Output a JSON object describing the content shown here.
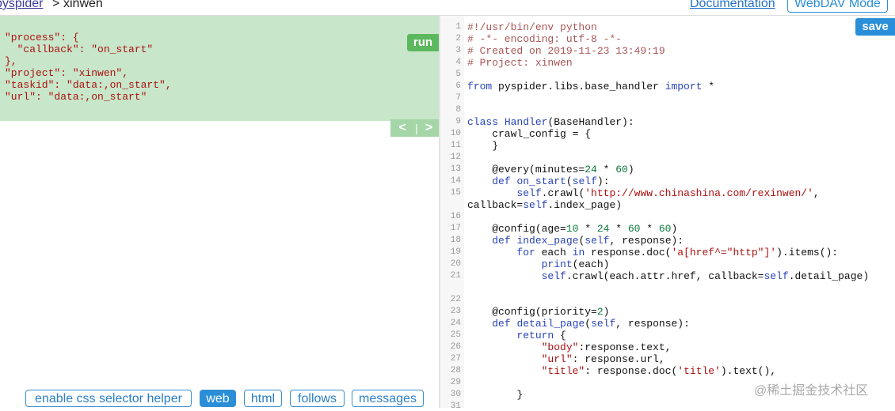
{
  "header": {
    "project_link": "pyspider",
    "separator": ">",
    "page_name": "xinwen",
    "documentation_link": "Documentation",
    "webdav_button": "WebDAV Mode"
  },
  "task_pane": {
    "run_label": "run",
    "json_text": "\"process\": {\n  \"callback\": \"on_start\"\n},\n\"project\": \"xinwen\",\n\"taskid\": \"data:,on_start\",\n\"url\": \"data:,on_start\"",
    "prev_label": "<",
    "nav_separator": "|",
    "next_label": ">",
    "background_color": "#c8e6c9"
  },
  "tabs": [
    {
      "label": "enable css selector helper",
      "active": false
    },
    {
      "label": "web",
      "active": true
    },
    {
      "label": "html",
      "active": false
    },
    {
      "label": "follows",
      "active": false
    },
    {
      "label": "messages",
      "active": false
    }
  ],
  "editor": {
    "save_label": "save",
    "lines": [
      {
        "n": "1",
        "segs": [
          [
            "com",
            "#!/usr/bin/env python"
          ]
        ]
      },
      {
        "n": "2",
        "segs": [
          [
            "com",
            "# -*- encoding: utf-8 -*-"
          ]
        ]
      },
      {
        "n": "3",
        "segs": [
          [
            "com",
            "# Created on 2019-11-23 13:49:19"
          ]
        ]
      },
      {
        "n": "4",
        "segs": [
          [
            "com",
            "# Project: xinwen"
          ]
        ]
      },
      {
        "n": "5",
        "segs": []
      },
      {
        "n": "6",
        "segs": [
          [
            "kw",
            "from"
          ],
          [
            "",
            " pyspider.libs.base_handler "
          ],
          [
            "kw",
            "import"
          ],
          [
            "",
            " *"
          ]
        ]
      },
      {
        "n": "7",
        "segs": []
      },
      {
        "n": "8",
        "segs": []
      },
      {
        "n": "9",
        "segs": [
          [
            "kw",
            "class"
          ],
          [
            "",
            " "
          ],
          [
            "def",
            "Handler"
          ],
          [
            "",
            "(BaseHandler):"
          ]
        ]
      },
      {
        "n": "10",
        "segs": [
          [
            "",
            "    crawl_config = {"
          ]
        ]
      },
      {
        "n": "11",
        "segs": [
          [
            "",
            "    }"
          ]
        ]
      },
      {
        "n": "12",
        "segs": []
      },
      {
        "n": "13",
        "segs": [
          [
            "",
            "    @every(minutes="
          ],
          [
            "num",
            "24"
          ],
          [
            "",
            " * "
          ],
          [
            "num",
            "60"
          ],
          [
            "",
            ")"
          ]
        ]
      },
      {
        "n": "14",
        "segs": [
          [
            "",
            "    "
          ],
          [
            "kw",
            "def"
          ],
          [
            "",
            " "
          ],
          [
            "def",
            "on_start"
          ],
          [
            "",
            "("
          ],
          [
            "self",
            "self"
          ],
          [
            "",
            "):"
          ]
        ]
      },
      {
        "n": "15",
        "segs": [
          [
            "",
            "        "
          ],
          [
            "self",
            "self"
          ],
          [
            "",
            ".crawl("
          ],
          [
            "str",
            "'http://www.chinashina.com/rexinwen/'"
          ],
          [
            "",
            ","
          ]
        ]
      },
      {
        "n": "",
        "segs": [
          [
            "",
            "callback="
          ],
          [
            "self",
            "self"
          ],
          [
            "",
            ".index_page)"
          ]
        ]
      },
      {
        "n": "16",
        "segs": []
      },
      {
        "n": "17",
        "segs": [
          [
            "",
            "    @config(age="
          ],
          [
            "num",
            "10"
          ],
          [
            "",
            " * "
          ],
          [
            "num",
            "24"
          ],
          [
            "",
            " * "
          ],
          [
            "num",
            "60"
          ],
          [
            "",
            " * "
          ],
          [
            "num",
            "60"
          ],
          [
            "",
            ")"
          ]
        ]
      },
      {
        "n": "18",
        "segs": [
          [
            "",
            "    "
          ],
          [
            "kw",
            "def"
          ],
          [
            "",
            " "
          ],
          [
            "def",
            "index_page"
          ],
          [
            "",
            "("
          ],
          [
            "self",
            "self"
          ],
          [
            "",
            ", response):"
          ]
        ]
      },
      {
        "n": "19",
        "segs": [
          [
            "",
            "        "
          ],
          [
            "kw",
            "for"
          ],
          [
            "",
            " each "
          ],
          [
            "kw",
            "in"
          ],
          [
            "",
            " response.doc("
          ],
          [
            "str",
            "'a[href^=\"http\"]'"
          ],
          [
            "",
            ").items():"
          ]
        ]
      },
      {
        "n": "20",
        "segs": [
          [
            "",
            "            "
          ],
          [
            "kw",
            "print"
          ],
          [
            "",
            "(each)"
          ]
        ]
      },
      {
        "n": "21",
        "segs": [
          [
            "",
            "            "
          ],
          [
            "self",
            "self"
          ],
          [
            "",
            ".crawl(each.attr.href, callback="
          ],
          [
            "self",
            "self"
          ],
          [
            "",
            ".detail_page)"
          ]
        ]
      },
      {
        "n": "",
        "segs": []
      },
      {
        "n": "22",
        "segs": []
      },
      {
        "n": "23",
        "segs": [
          [
            "",
            "    @config(priority="
          ],
          [
            "num",
            "2"
          ],
          [
            "",
            ")"
          ]
        ]
      },
      {
        "n": "24",
        "segs": [
          [
            "",
            "    "
          ],
          [
            "kw",
            "def"
          ],
          [
            "",
            " "
          ],
          [
            "def",
            "detail_page"
          ],
          [
            "",
            "("
          ],
          [
            "self",
            "self"
          ],
          [
            "",
            ", response):"
          ]
        ]
      },
      {
        "n": "25",
        "segs": [
          [
            "",
            "        "
          ],
          [
            "kw",
            "return"
          ],
          [
            "",
            " {"
          ]
        ]
      },
      {
        "n": "26",
        "segs": [
          [
            "",
            "            "
          ],
          [
            "str",
            "\"body\""
          ],
          [
            "",
            ":response.text,"
          ]
        ]
      },
      {
        "n": "27",
        "segs": [
          [
            "",
            "            "
          ],
          [
            "str",
            "\"url\""
          ],
          [
            "",
            ": response.url,"
          ]
        ]
      },
      {
        "n": "28",
        "segs": [
          [
            "",
            "            "
          ],
          [
            "str",
            "\"title\""
          ],
          [
            "",
            ": response.doc("
          ],
          [
            "str",
            "'title'"
          ],
          [
            "",
            ").text(),"
          ]
        ]
      },
      {
        "n": "29",
        "segs": []
      },
      {
        "n": "30",
        "segs": [
          [
            "",
            "        }"
          ]
        ]
      },
      {
        "n": "31",
        "segs": []
      }
    ]
  },
  "watermark": "@稀土掘金技术社区"
}
